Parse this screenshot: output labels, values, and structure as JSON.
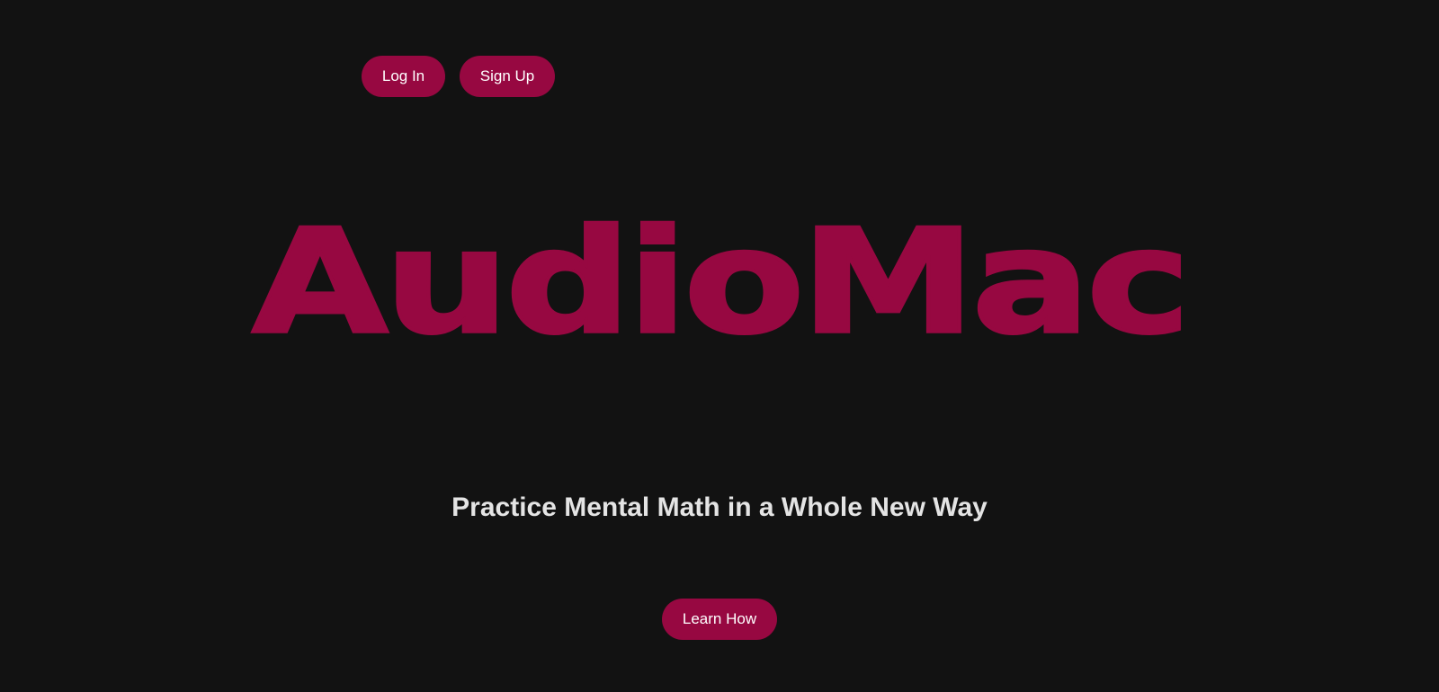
{
  "header": {
    "login_label": "Log In",
    "signup_label": "Sign Up"
  },
  "hero": {
    "brand": "AudioMac",
    "tagline": "Practice Mental Math in a Whole New Way",
    "cta_label": "Learn How"
  },
  "colors": {
    "background": "#121212",
    "accent": "#970841",
    "button_text": "#ffffff",
    "tagline_text": "#e4e4e4"
  }
}
